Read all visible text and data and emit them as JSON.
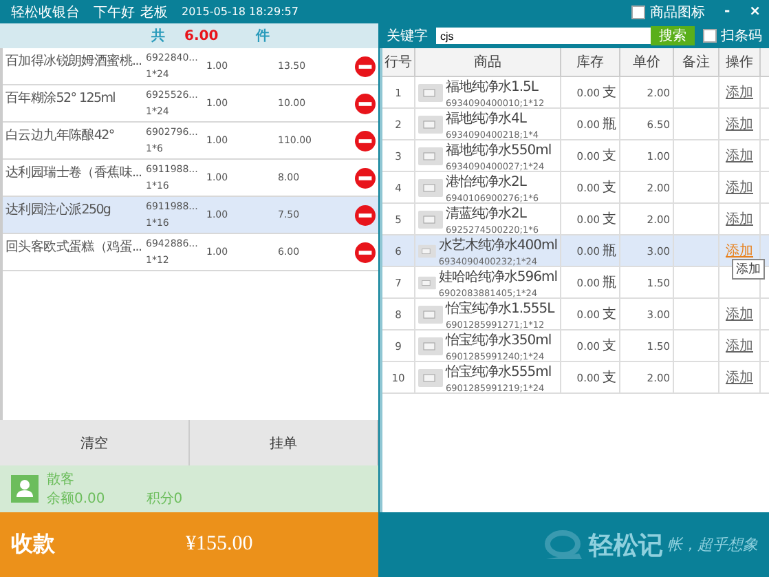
{
  "app": {
    "title": "轻松收银台",
    "greeting": "下午好",
    "user": "老板",
    "datetime": "2015-05-18 18:29:57"
  },
  "cart_summary": {
    "prefix": "共",
    "count": "6.00",
    "unit": "件"
  },
  "cart_items": [
    {
      "name": "百加得冰锐朗姆酒蜜桃...",
      "code": "6922840...",
      "spec": "1*24",
      "qty": "1.00",
      "price": "13.50",
      "selected": false
    },
    {
      "name": "百年糊涂52° 125ml",
      "code": "6925526...",
      "spec": "1*24",
      "qty": "1.00",
      "price": "10.00",
      "selected": false
    },
    {
      "name": "白云边九年陈酿42°",
      "code": "6902796...",
      "spec": "1*6",
      "qty": "1.00",
      "price": "110.00",
      "selected": false
    },
    {
      "name": "达利园瑞士卷（香蕉味...",
      "code": "6911988...",
      "spec": "1*16",
      "qty": "1.00",
      "price": "8.00",
      "selected": false
    },
    {
      "name": "达利园注心派250g",
      "code": "6911988...",
      "spec": "1*16",
      "qty": "1.00",
      "price": "7.50",
      "selected": true
    },
    {
      "name": "回头客欧式蛋糕（鸡蛋...",
      "code": "6942886...",
      "spec": "1*12",
      "qty": "1.00",
      "price": "6.00",
      "selected": false
    }
  ],
  "cart_buttons": [
    "清空",
    "挂单"
  ],
  "customer": {
    "name": "散客",
    "balance": "余额0.00",
    "points": "积分0"
  },
  "checkout": {
    "label": "收款",
    "amount": "¥155.00"
  },
  "window_controls": {
    "show_icons": {
      "label": "商品图标",
      "checked": false
    },
    "minimize": "-",
    "close": "×"
  },
  "search": {
    "label": "关键字",
    "value": "cjs",
    "button": "搜索",
    "scan": {
      "label": "扫条码",
      "checked": false
    }
  },
  "table": {
    "columns": [
      "行号",
      "商品",
      "库存",
      "单价",
      "备注",
      "操作"
    ],
    "rows": [
      {
        "index": "1",
        "name": "福地纯净水1.5L",
        "barcode": "6934090400010;1*12",
        "stock": "0.00",
        "unit": "支",
        "price": "2.00",
        "action": "添加",
        "selected": false
      },
      {
        "index": "2",
        "name": "福地纯净水4L",
        "barcode": "6934090400218;1*4",
        "stock": "0.00",
        "unit": "瓶",
        "price": "6.50",
        "action": "添加",
        "selected": false
      },
      {
        "index": "3",
        "name": "福地纯净水550ml",
        "barcode": "6934090400027;1*24",
        "stock": "0.00",
        "unit": "支",
        "price": "1.00",
        "action": "添加",
        "selected": false
      },
      {
        "index": "4",
        "name": "港怡纯净水2L",
        "barcode": "6940106900276;1*6",
        "stock": "0.00",
        "unit": "支",
        "price": "2.00",
        "action": "添加",
        "selected": false
      },
      {
        "index": "5",
        "name": "清蓝纯净水2L",
        "barcode": "6925274500220;1*6",
        "stock": "0.00",
        "unit": "支",
        "price": "2.00",
        "action": "添加",
        "selected": false
      },
      {
        "index": "6",
        "name": "水艺木纯净水400ml",
        "barcode": "6934090400232;1*24",
        "stock": "0.00",
        "unit": "瓶",
        "price": "3.00",
        "action": "添加",
        "selected": true
      },
      {
        "index": "7",
        "name": "娃哈哈纯净水596ml",
        "barcode": "6902083881405;1*24",
        "stock": "0.00",
        "unit": "瓶",
        "price": "1.50",
        "selected": false
      },
      {
        "index": "8",
        "name": "怡宝纯净水1.555L",
        "barcode": "6901285991271;1*12",
        "stock": "0.00",
        "unit": "支",
        "price": "3.00",
        "action": "添加",
        "selected": false
      },
      {
        "index": "9",
        "name": "怡宝纯净水350ml",
        "barcode": "6901285991240;1*24",
        "stock": "0.00",
        "unit": "支",
        "price": "1.50",
        "action": "添加",
        "selected": false
      },
      {
        "index": "10",
        "name": "怡宝纯净水555ml",
        "barcode": "6901285991219;1*24",
        "stock": "0.00",
        "unit": "支",
        "price": "2.00",
        "action": "添加",
        "selected": false
      }
    ]
  },
  "tooltip": "添加",
  "brand": {
    "logo": "轻松记",
    "tagline": "帐，超乎想象"
  }
}
